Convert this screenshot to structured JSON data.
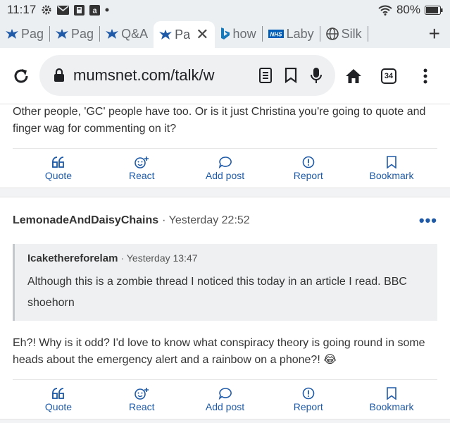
{
  "status_bar": {
    "time": "11:17",
    "battery_text": "80%",
    "notification_icons": [
      "gear-icon",
      "mail-icon",
      "app-icon",
      "amazon-icon",
      "dot-icon"
    ]
  },
  "tabs": [
    {
      "title": "Pag",
      "icon": "mumsnet-icon",
      "active": false
    },
    {
      "title": "Pag",
      "icon": "mumsnet-icon",
      "active": false
    },
    {
      "title": "Q&A",
      "icon": "mumsnet-icon",
      "active": false
    },
    {
      "title": "Pa",
      "icon": "mumsnet-icon",
      "active": true
    },
    {
      "title": "how",
      "icon": "bing-icon",
      "active": false
    },
    {
      "title": "Laby",
      "icon": "nhs-icon",
      "active": false
    },
    {
      "title": "Silk",
      "icon": "globe-icon",
      "active": false
    }
  ],
  "toolbar": {
    "url": "mumsnet.com/talk/w",
    "tab_count": "34"
  },
  "posts": [
    {
      "text": "Other people, 'GC' people have too. Or is it just Christina you're going to quote and finger wag for commenting on it?"
    },
    {
      "author": "LemonadeAndDaisyChains",
      "time": "· Yesterday 22:52",
      "quote": {
        "author": "Icakethereforelam",
        "time": "· Yesterday 13:47",
        "text": "Although this is a zombie thread I noticed this today in an article I read. BBC shoehorn"
      },
      "text": "Eh?! Why is it odd? I'd love to know what conspiracy theory is going round in some heads about the emergency alert and a rainbow on a phone?! 😂"
    }
  ],
  "actions": {
    "quote": "Quote",
    "react": "React",
    "add_post": "Add post",
    "report": "Report",
    "bookmark": "Bookmark"
  },
  "colors": {
    "accent": "#1e5aa8",
    "chrome_bg": "#eceff1"
  }
}
